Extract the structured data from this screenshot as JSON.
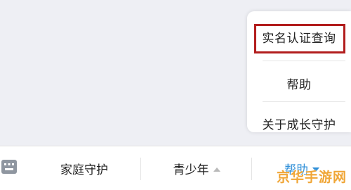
{
  "popup_menu": {
    "items": [
      {
        "label": "实名认证查询"
      },
      {
        "label": "帮助"
      },
      {
        "label": "关于成长守护"
      }
    ],
    "highlight_color": "#b21d1d"
  },
  "bottom_menu": {
    "items": [
      {
        "label": "家庭守护"
      },
      {
        "label": "青少年"
      },
      {
        "label": "帮助"
      }
    ],
    "active_color": "#2f8fd8"
  },
  "icons": {
    "keyboard": "keyboard-icon",
    "submenu_up": "triangle-up-icon",
    "submenu_down": "triangle-down-icon"
  },
  "watermark": {
    "text": "京华手游网",
    "color": "#f0a637"
  }
}
